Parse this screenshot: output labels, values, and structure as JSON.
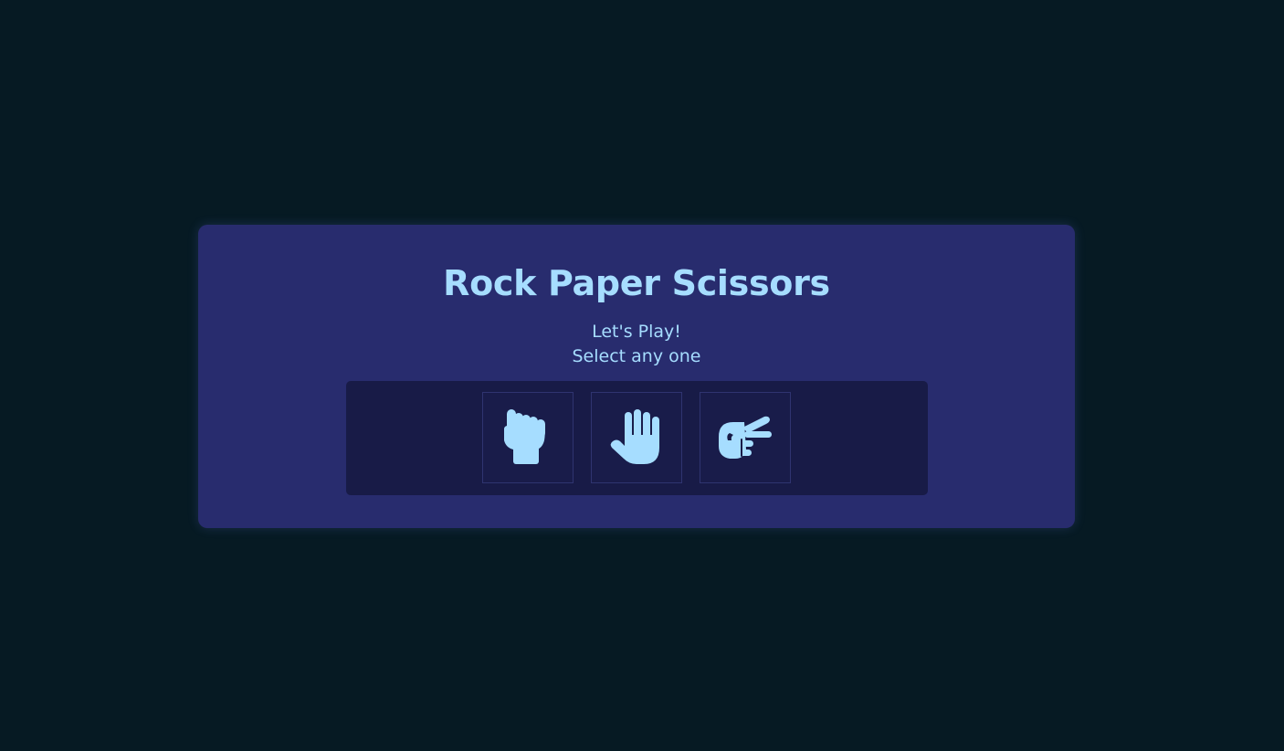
{
  "game": {
    "title": "Rock Paper Scissors",
    "subtitle_line1": "Let's Play!",
    "subtitle_line2": "Select any one"
  },
  "choices": [
    {
      "name": "rock",
      "icon": "hand-fist-icon"
    },
    {
      "name": "paper",
      "icon": "hand-open-icon"
    },
    {
      "name": "scissors",
      "icon": "hand-scissors-icon"
    }
  ],
  "colors": {
    "background": "#061a23",
    "card": "#282c6e",
    "panel": "#181b47",
    "accent": "#a6ddff"
  }
}
